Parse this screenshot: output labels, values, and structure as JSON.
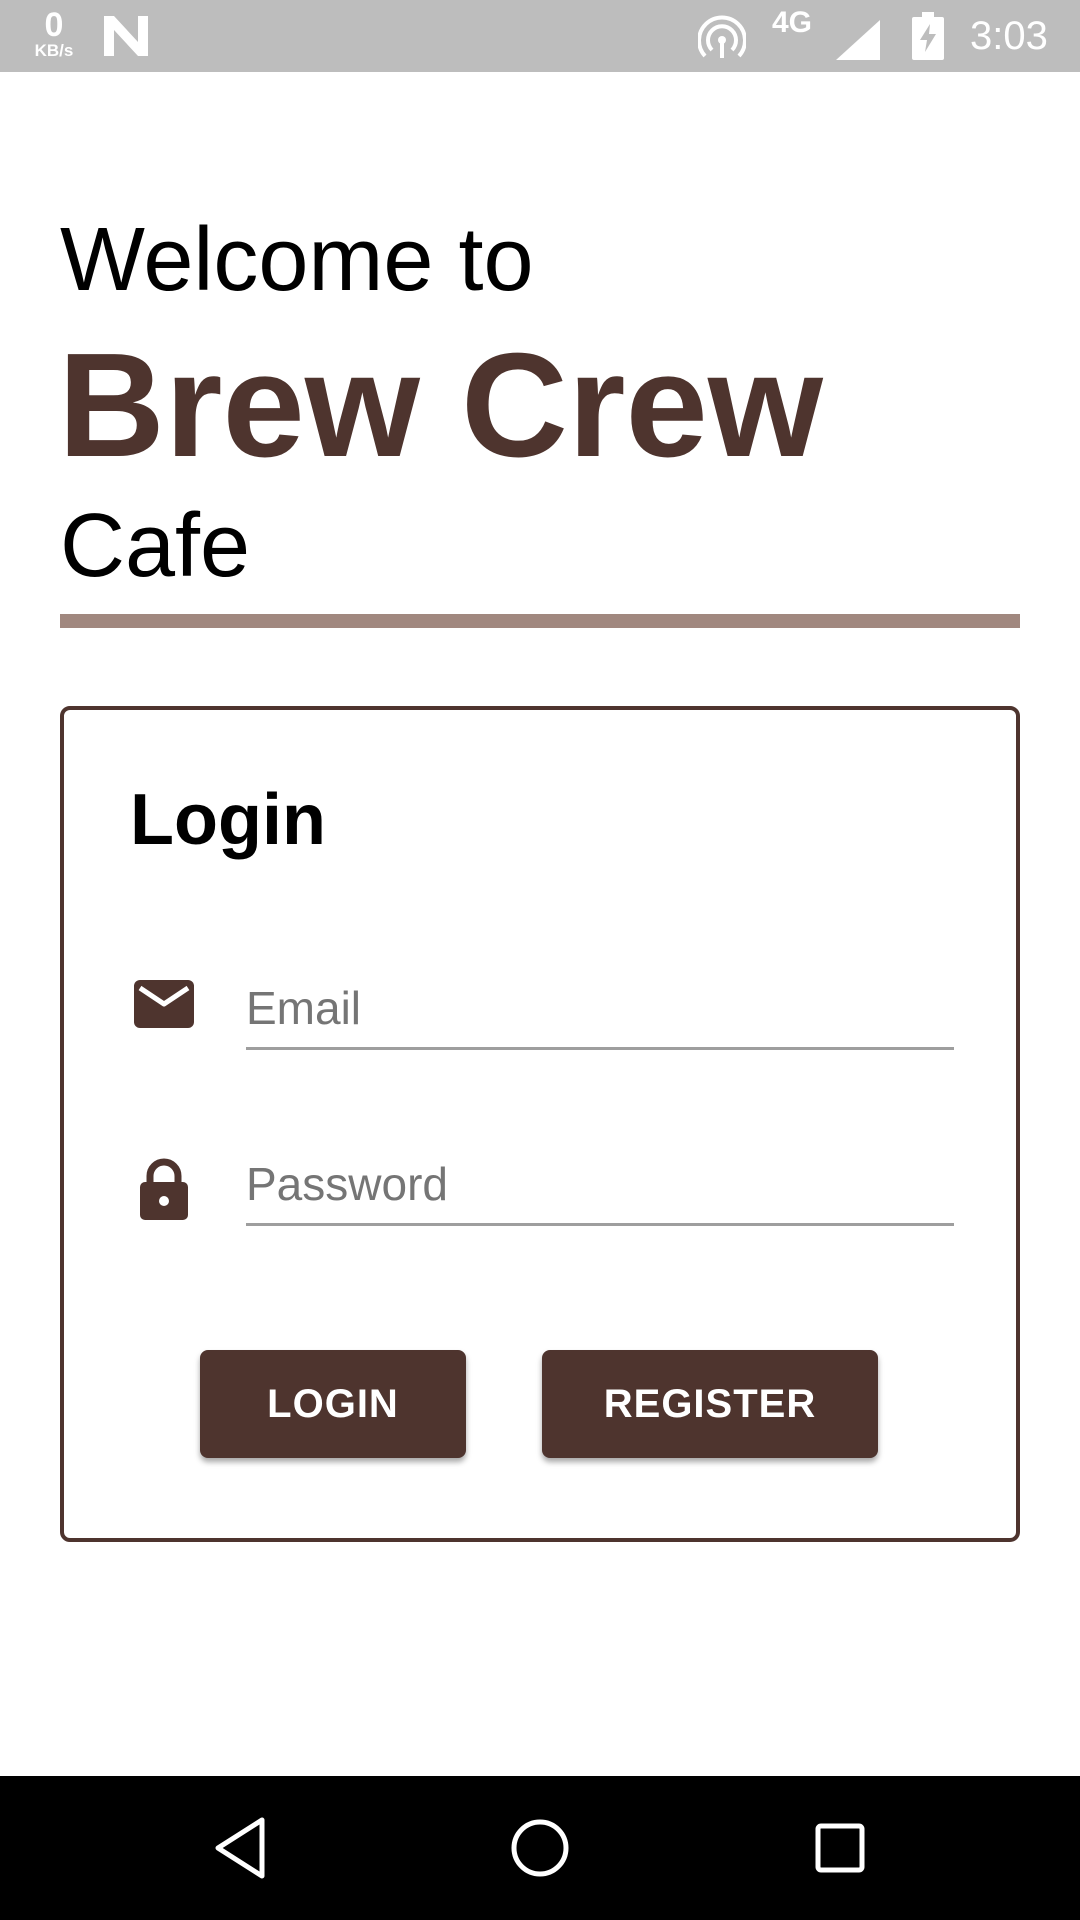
{
  "status_bar": {
    "speed_value": "0",
    "speed_unit": "KB/s",
    "network": "4G",
    "time": "3:03",
    "icons": [
      "n-icon",
      "hotspot-icon",
      "signal-icon",
      "battery-icon"
    ]
  },
  "header": {
    "welcome": "Welcome to",
    "brand": "Brew Crew",
    "subtitle": "Cafe"
  },
  "login": {
    "title": "Login",
    "email": {
      "placeholder": "Email",
      "value": "",
      "icon": "envelope-icon"
    },
    "password": {
      "placeholder": "Password",
      "value": "",
      "icon": "lock-icon"
    },
    "login_button": "LOGIN",
    "register_button": "REGISTER"
  },
  "nav_bar": {
    "buttons": [
      "back-icon",
      "home-icon",
      "recents-icon"
    ]
  },
  "colors": {
    "brand": "#4e342e",
    "divider": "#a1887f",
    "status_bar": "#bdbdbd",
    "nav_bar": "#000000"
  }
}
